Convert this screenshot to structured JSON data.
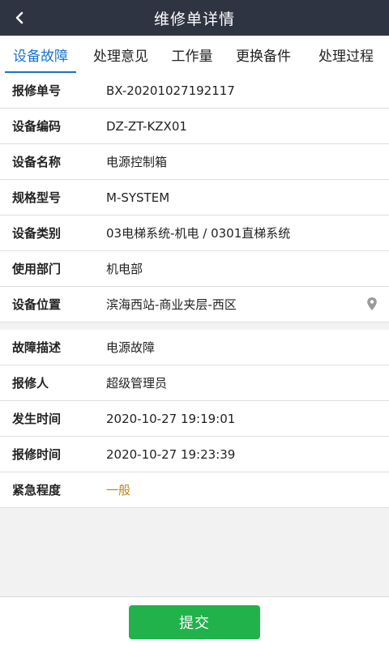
{
  "header": {
    "title": "维修单详情",
    "back_icon": "chevron-left-icon"
  },
  "tabs": [
    {
      "label": "设备故障",
      "active": true
    },
    {
      "label": "处理意见"
    },
    {
      "label": "工作量"
    },
    {
      "label": "更换备件"
    },
    {
      "label": "处理过程"
    }
  ],
  "device_info": [
    {
      "label": "报修单号",
      "value": "BX-20201027192117"
    },
    {
      "label": "设备编码",
      "value": "DZ-ZT-KZX01"
    },
    {
      "label": "设备名称",
      "value": "电源控制箱"
    },
    {
      "label": "规格型号",
      "value": "M-SYSTEM"
    },
    {
      "label": "设备类别",
      "value": "03电梯系统-机电 / 0301直梯系统"
    },
    {
      "label": "使用部门",
      "value": "机电部"
    },
    {
      "label": "设备位置",
      "value": "滨海西站-商业夹层-西区",
      "icon": "location-pin-icon"
    }
  ],
  "fault_info": [
    {
      "label": "故障描述",
      "value": "电源故障"
    },
    {
      "label": "报修人",
      "value": "超级管理员"
    },
    {
      "label": "发生时间",
      "value": "2020-10-27 19:19:01"
    },
    {
      "label": "报修时间",
      "value": "2020-10-27 19:23:39"
    },
    {
      "label": "紧急程度",
      "value": "一般"
    }
  ],
  "colors": {
    "header_bg": "#2f3442",
    "tab_active": "#1a73c7",
    "urgency": "#c0841a",
    "submit_bg": "#22b24c"
  },
  "footer": {
    "submit_label": "提交"
  }
}
